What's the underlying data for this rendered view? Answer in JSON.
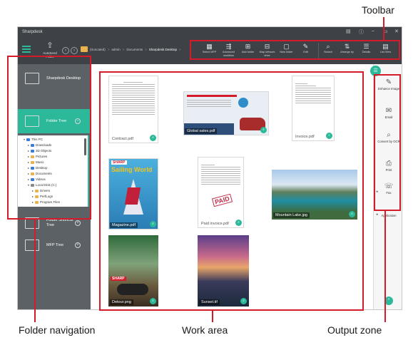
{
  "callouts": {
    "toolbar": "Toolbar",
    "folder_navigation": "Folder navigation",
    "work_area": "Work area",
    "output_zone": "Output zone"
  },
  "window": {
    "title": "Sharpdesk"
  },
  "topbar": {
    "autosend_label": "AutoSend Folder",
    "breadcrumb": [
      "(truncated)",
      "admin",
      "Documents",
      "Sharpdesk Desktop"
    ]
  },
  "toolbar": {
    "tools": [
      {
        "icon": "select-mfp-icon",
        "label": "Select MFP"
      },
      {
        "icon": "workflow-icon",
        "label": "Advanced workflow"
      },
      {
        "icon": "folder-add-icon",
        "label": "Add folder"
      },
      {
        "icon": "map-folder-icon",
        "label": "Map network drive"
      },
      {
        "icon": "new-folder-icon",
        "label": "New folder"
      },
      {
        "icon": "edit-icon",
        "label": "Edit"
      },
      {
        "icon": "search-icon",
        "label": "Search"
      },
      {
        "icon": "arrange-icon",
        "label": "Arrange by"
      },
      {
        "icon": "details-icon",
        "label": "Details"
      },
      {
        "icon": "list-view-icon",
        "label": "List View"
      }
    ]
  },
  "sidebar": {
    "desktop_label": "Sharpdesk Desktop",
    "folder_tree_label": "Folder Tree",
    "shortcut_label": "Folder Shortcut Tree",
    "mfp_label": "MFP Tree",
    "tree": [
      {
        "label": "This PC",
        "level": 0,
        "color": "#3b7bd8"
      },
      {
        "label": "Downloads",
        "level": 1,
        "color": "#3b7bd8"
      },
      {
        "label": "3D Objects",
        "level": 1,
        "color": "#3b7bd8"
      },
      {
        "label": "Pictures",
        "level": 1,
        "color": "#e9b24c"
      },
      {
        "label": "Music",
        "level": 1,
        "color": "#e9b24c"
      },
      {
        "label": "Desktop",
        "level": 1,
        "color": "#3b7bd8"
      },
      {
        "label": "Documents",
        "level": 1,
        "color": "#e9b24c"
      },
      {
        "label": "Videos",
        "level": 1,
        "color": "#3b7bd8"
      },
      {
        "label": "Local Disk (C:)",
        "level": 1,
        "color": "#888888"
      },
      {
        "label": "Drivers",
        "level": 2,
        "color": "#e9b24c"
      },
      {
        "label": "PerfLogs",
        "level": 2,
        "color": "#e9b24c"
      },
      {
        "label": "Program Files",
        "level": 2,
        "color": "#e9b24c"
      }
    ]
  },
  "files": [
    {
      "name": "Contract.pdf",
      "kind": "text"
    },
    {
      "name": "Global sales.pdf",
      "kind": "sales"
    },
    {
      "name": "Invoice.pdf",
      "kind": "invoice"
    },
    {
      "name": "Magazine.pdf",
      "kind": "magazine",
      "brand": "SHARP",
      "headline": "Sailing World"
    },
    {
      "name": "Paid invoice.pdf",
      "kind": "paid",
      "stamp": "PAID"
    },
    {
      "name": "Mountain Lake.jpg",
      "kind": "lake"
    },
    {
      "name": "Detour.png",
      "kind": "moto",
      "brand": "SHARP"
    },
    {
      "name": "Sunset.tif",
      "kind": "sunset"
    }
  ],
  "output_zone": [
    {
      "icon": "enhance-image-icon",
      "label": "Enhance Image"
    },
    {
      "icon": "email-icon",
      "label": "Email"
    },
    {
      "icon": "ocr-icon",
      "label": "Convert by OCR"
    },
    {
      "icon": "print-icon",
      "label": "Print"
    },
    {
      "icon": "fax-icon",
      "label": "Fax"
    },
    {
      "icon": "application-icon",
      "label": "Application"
    }
  ],
  "colors": {
    "accent": "#2bb99a",
    "chrome": "#3e4247",
    "sidebar": "#5c6166",
    "highlight": "#d51a2a"
  }
}
